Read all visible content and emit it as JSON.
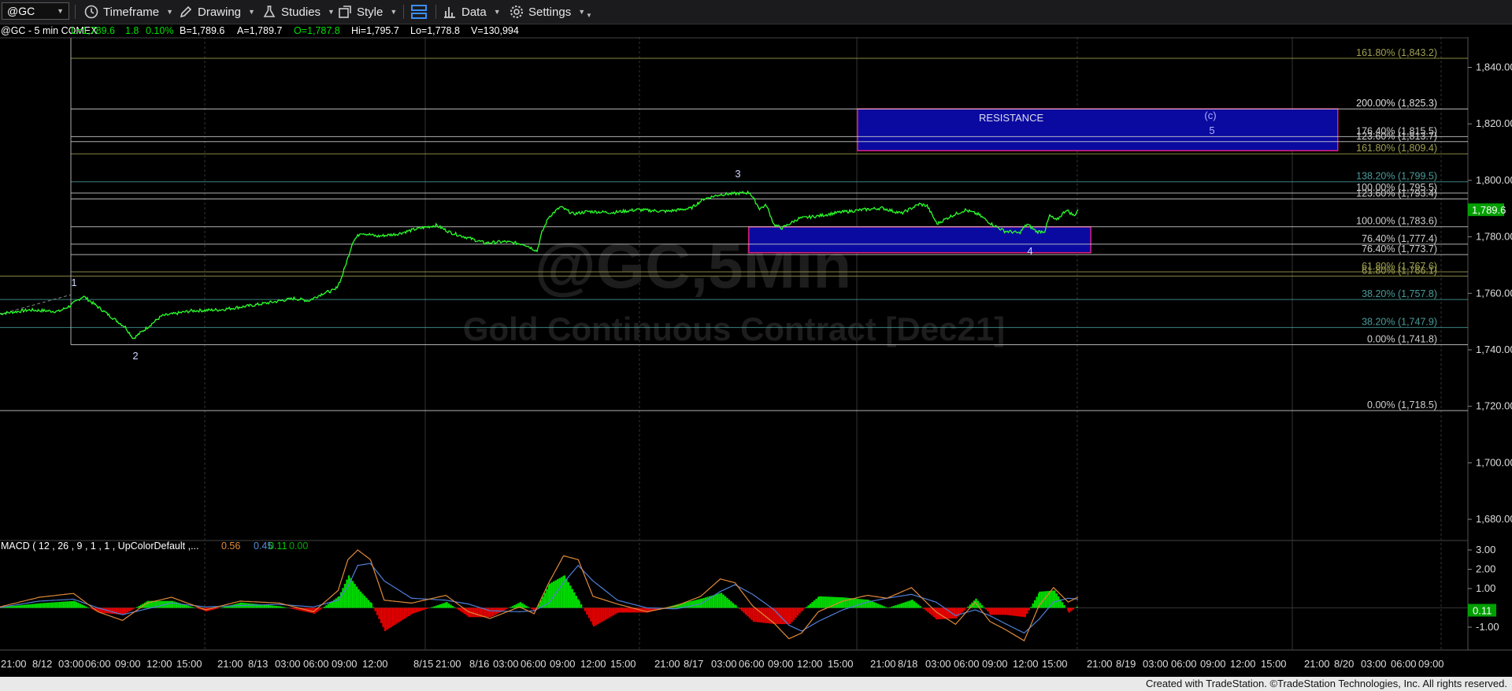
{
  "toolbar": {
    "symbol": "@GC",
    "timeframe_label": "Timeframe",
    "drawing_label": "Drawing",
    "studies_label": "Studies",
    "style_label": "Style",
    "data_label": "Data",
    "settings_label": "Settings"
  },
  "header": {
    "title": "@GC - 5 min  COMEX",
    "last": "L=1,789.6",
    "change": "1.8",
    "change_pct": "0.10%",
    "bid": "B=1,789.6",
    "ask": "A=1,789.7",
    "open": "O=1,787.8",
    "high": "Hi=1,795.7",
    "low": "Lo=1,778.8",
    "volume": "V=130,994"
  },
  "watermark": {
    "symbol": "@GC,5Min",
    "name": "Gold Continuous Contract [Dec21]"
  },
  "price_axis": {
    "ticks": [
      "1,840.00",
      "1,820.00",
      "1,800.00",
      "1,780.00",
      "1,760.00",
      "1,740.00",
      "1,720.00",
      "1,700.00",
      "1,680.00"
    ],
    "last_price": "1,789.6"
  },
  "time_axis": {
    "labels": [
      "21:00",
      "8/12",
      "03:00",
      "06:00",
      "09:00",
      "12:00",
      "15:00",
      "21:00",
      "8/13",
      "03:00",
      "06:00",
      "09:00",
      "12:00",
      "8/15",
      "21:00",
      "8/16",
      "03:00",
      "06:00",
      "09:00",
      "12:00",
      "15:00",
      "21:00",
      "8/17",
      "03:00",
      "06:00",
      "09:00",
      "12:00",
      "15:00",
      "21:00",
      "8/18",
      "03:00",
      "06:00",
      "09:00",
      "12:00",
      "15:00",
      "21:00",
      "8/19",
      "03:00",
      "06:00",
      "09:00",
      "12:00",
      "15:00",
      "21:00",
      "8/20",
      "03:00",
      "06:00",
      "09:00"
    ]
  },
  "fib_levels": [
    {
      "label": "161.80% (1,843.2)",
      "price": 1843.2,
      "color": "#a0a050"
    },
    {
      "label": "200.00% (1,825.3)",
      "price": 1825.3,
      "color": "#e0e0e0"
    },
    {
      "label": "176.40% (1,815.5)",
      "price": 1815.5,
      "color": "#d0d0d0"
    },
    {
      "label": "123.60% (1,813.7)",
      "price": 1813.7,
      "color": "#d0d0d0"
    },
    {
      "label": "161.80% (1,809.4)",
      "price": 1809.4,
      "color": "#a0a050"
    },
    {
      "label": "138.20% (1,799.5)",
      "price": 1799.5,
      "color": "#4a9a9a"
    },
    {
      "label": "100.00% (1,795.5)",
      "price": 1795.5,
      "color": "#d0d0d0"
    },
    {
      "label": "123.60% (1,793.4)",
      "price": 1793.4,
      "color": "#d0d0d0"
    },
    {
      "label": "100.00% (1,783.6)",
      "price": 1783.6,
      "color": "#d0d0d0"
    },
    {
      "label": "76.40% (1,777.4)",
      "price": 1777.4,
      "color": "#d0d0d0"
    },
    {
      "label": "76.40% (1,773.7)",
      "price": 1773.7,
      "color": "#d0d0d0"
    },
    {
      "label": "61.80% (1,767.6)",
      "price": 1767.6,
      "color": "#a0a050"
    },
    {
      "label": "61.80% (1,766.1)",
      "price": 1766.1,
      "color": "#a0a050"
    },
    {
      "label": "38.20% (1,757.8)",
      "price": 1757.8,
      "color": "#4a9a9a"
    },
    {
      "label": "38.20% (1,747.9)",
      "price": 1747.9,
      "color": "#4a9a9a"
    },
    {
      "label": "0.00% (1,741.8)",
      "price": 1741.8,
      "color": "#d0d0d0"
    },
    {
      "label": "0.00% (1,718.5)",
      "price": 1718.5,
      "color": "#d0d0d0"
    }
  ],
  "zones": [
    {
      "label": "RESISTANCE",
      "price_top": 1825.3,
      "price_bottom": 1810.5,
      "start_bar": 875,
      "end_bar": 1365
    },
    {
      "label": "",
      "price_top": 1783.5,
      "price_bottom": 1774.4,
      "start_bar": 764,
      "end_bar": 1113
    }
  ],
  "wave_labels": [
    "1",
    "2",
    "3",
    "4",
    "(c)",
    "5"
  ],
  "price_series": [
    [
      0,
      1752.8
    ],
    [
      30,
      1754.1
    ],
    [
      60,
      1753.6
    ],
    [
      71,
      1755.5
    ],
    [
      85,
      1759.0
    ],
    [
      100,
      1755.2
    ],
    [
      115,
      1751.3
    ],
    [
      128,
      1748.0
    ],
    [
      136,
      1744.0
    ],
    [
      145,
      1746.5
    ],
    [
      165,
      1752.0
    ],
    [
      195,
      1753.8
    ],
    [
      225,
      1754.2
    ],
    [
      255,
      1755.6
    ],
    [
      280,
      1757.0
    ],
    [
      300,
      1758.2
    ],
    [
      315,
      1757.4
    ],
    [
      330,
      1760.1
    ],
    [
      342,
      1761.2
    ],
    [
      348,
      1765.0
    ],
    [
      355,
      1772.6
    ],
    [
      360,
      1778.3
    ],
    [
      368,
      1781.5
    ],
    [
      385,
      1780.2
    ],
    [
      405,
      1781.0
    ],
    [
      425,
      1782.8
    ],
    [
      445,
      1784.1
    ],
    [
      460,
      1781.5
    ],
    [
      478,
      1779.6
    ],
    [
      495,
      1777.8
    ],
    [
      515,
      1778.3
    ],
    [
      535,
      1777.4
    ],
    [
      548,
      1775.0
    ],
    [
      553,
      1781.6
    ],
    [
      560,
      1787.1
    ],
    [
      572,
      1790.6
    ],
    [
      585,
      1788.1
    ],
    [
      600,
      1789.0
    ],
    [
      625,
      1788.6
    ],
    [
      650,
      1789.6
    ],
    [
      680,
      1789.0
    ],
    [
      705,
      1790.1
    ],
    [
      718,
      1793.4
    ],
    [
      735,
      1795.0
    ],
    [
      750,
      1795.3
    ],
    [
      765,
      1795.7
    ],
    [
      775,
      1790.0
    ],
    [
      782,
      1791.2
    ],
    [
      790,
      1784.2
    ],
    [
      798,
      1783.1
    ],
    [
      815,
      1786.5
    ],
    [
      835,
      1787.4
    ],
    [
      855,
      1788.6
    ],
    [
      878,
      1789.5
    ],
    [
      900,
      1790.2
    ],
    [
      920,
      1788.3
    ],
    [
      938,
      1791.6
    ],
    [
      946,
      1791.0
    ],
    [
      956,
      1784.6
    ],
    [
      970,
      1787.3
    ],
    [
      985,
      1789.5
    ],
    [
      998,
      1788.0
    ],
    [
      1012,
      1784.5
    ],
    [
      1025,
      1782.0
    ],
    [
      1032,
      1781.8
    ],
    [
      1040,
      1781.3
    ],
    [
      1048,
      1784.5
    ],
    [
      1058,
      1781.8
    ],
    [
      1066,
      1782.0
    ],
    [
      1071,
      1787.5
    ],
    [
      1078,
      1785.8
    ],
    [
      1088,
      1789.6
    ],
    [
      1096,
      1787.4
    ],
    [
      1100,
      1789.6
    ]
  ],
  "macd": {
    "label": "MACD ( 12 , 26 , 9 , 1 , 1 , UpColorDefault ,...",
    "values": [
      "0.56",
      "0.45",
      "0.11",
      "0.00"
    ],
    "value_colors": [
      "#e08a3a",
      "#5a8ad8",
      "#00d000",
      "#00aa00"
    ],
    "ticks": [
      "3.00",
      "2.00",
      "1.00",
      "-1.00"
    ],
    "last": "0.11",
    "series": [
      [
        0,
        0.05,
        0.02
      ],
      [
        40,
        0.55,
        0.35
      ],
      [
        75,
        0.75,
        0.45
      ],
      [
        100,
        -0.2,
        0.0
      ],
      [
        125,
        -0.65,
        -0.35
      ],
      [
        150,
        0.25,
        -0.05
      ],
      [
        175,
        0.55,
        0.25
      ],
      [
        210,
        -0.1,
        0.05
      ],
      [
        245,
        0.35,
        0.12
      ],
      [
        285,
        0.25,
        0.18
      ],
      [
        320,
        -0.2,
        0.05
      ],
      [
        345,
        0.9,
        0.4
      ],
      [
        355,
        2.5,
        1.1
      ],
      [
        365,
        3.0,
        2.2
      ],
      [
        378,
        2.5,
        2.3
      ],
      [
        392,
        0.4,
        1.4
      ],
      [
        420,
        0.25,
        0.5
      ],
      [
        455,
        0.65,
        0.4
      ],
      [
        478,
        -0.2,
        0.2
      ],
      [
        500,
        -0.55,
        -0.15
      ],
      [
        530,
        0.05,
        -0.2
      ],
      [
        545,
        -0.3,
        -0.15
      ],
      [
        560,
        1.3,
        0.25
      ],
      [
        575,
        2.7,
        1.3
      ],
      [
        590,
        2.5,
        2.2
      ],
      [
        605,
        0.6,
        1.4
      ],
      [
        630,
        0.2,
        0.4
      ],
      [
        660,
        -0.2,
        0.0
      ],
      [
        690,
        0.1,
        -0.05
      ],
      [
        715,
        0.6,
        0.2
      ],
      [
        735,
        1.5,
        0.85
      ],
      [
        750,
        1.3,
        1.2
      ],
      [
        768,
        0.1,
        0.7
      ],
      [
        790,
        -0.8,
        -0.1
      ],
      [
        805,
        -1.6,
        -0.9
      ],
      [
        818,
        -1.3,
        -1.2
      ],
      [
        835,
        -0.2,
        -0.7
      ],
      [
        860,
        0.35,
        -0.1
      ],
      [
        885,
        0.65,
        0.3
      ],
      [
        905,
        0.5,
        0.5
      ],
      [
        930,
        1.05,
        0.7
      ],
      [
        955,
        -0.2,
        0.3
      ],
      [
        975,
        -0.85,
        -0.4
      ],
      [
        995,
        0.3,
        -0.1
      ],
      [
        1010,
        -0.7,
        -0.4
      ],
      [
        1025,
        -1.1,
        -0.8
      ],
      [
        1045,
        -1.7,
        -1.3
      ],
      [
        1060,
        0.1,
        -0.6
      ],
      [
        1075,
        1.05,
        0.3
      ],
      [
        1090,
        0.3,
        0.5
      ],
      [
        1100,
        0.56,
        0.45
      ]
    ]
  }
}
